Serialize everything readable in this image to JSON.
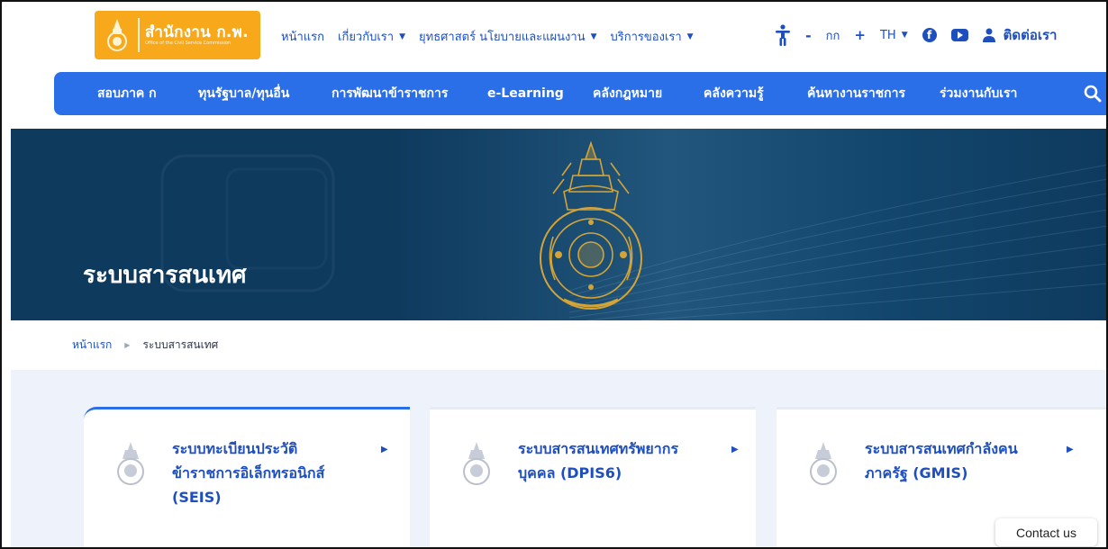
{
  "logo": {
    "main": "สำนักงาน ก.พ.",
    "sub": "Office of the Civil Service Commission"
  },
  "topnav": [
    {
      "label": "หน้าแรก",
      "has_caret": false
    },
    {
      "label": "เกี่ยวกับเรา",
      "has_caret": true
    },
    {
      "label": "ยุทธศาสตร์ นโยบายและแผนงาน",
      "has_caret": true
    },
    {
      "label": "บริการของเรา",
      "has_caret": true
    }
  ],
  "tools": {
    "accessibility_icon": "accessibility-icon",
    "font_decrease": "-",
    "font_label": "กก",
    "font_increase": "+",
    "language": "TH",
    "facebook_icon": "facebook-icon",
    "youtube_icon": "youtube-icon",
    "user_icon": "user-icon",
    "contact_label": "ติดต่อเรา"
  },
  "mainnav": [
    "สอบภาค ก",
    "ทุนรัฐบาล/ทุนอื่น",
    "การพัฒนาข้าราชการ",
    "e-Learning",
    "คลังกฎหมาย",
    "คลังความรู้",
    "ค้นหางานราชการ",
    "ร่วมงานกับเรา"
  ],
  "hero": {
    "title": "ระบบสารสนเทศ"
  },
  "breadcrumb": {
    "home": "หน้าแรก",
    "current": "ระบบสารสนเทศ"
  },
  "cards": [
    {
      "line1": "ระบบทะเบียนประวัติ",
      "line2": "ข้าราชการอิเล็กทรอนิกส์",
      "line3": "(SEIS)"
    },
    {
      "line1": "ระบบสารสนเทศทรัพยากร",
      "line2": "บุคคล (DPIS6)",
      "line3": ""
    },
    {
      "line1": "ระบบสารสนเทศกำลังคน",
      "line2": "ภาครัฐ (GMIS)",
      "line3": ""
    }
  ],
  "contact_us": "Contact us",
  "colors": {
    "brand_orange": "#f7a81b",
    "nav_blue": "#2a6ee8",
    "link_blue": "#1f4fbf",
    "hero_dark": "#0e3a5e",
    "emblem_gold": "#d4a437"
  }
}
